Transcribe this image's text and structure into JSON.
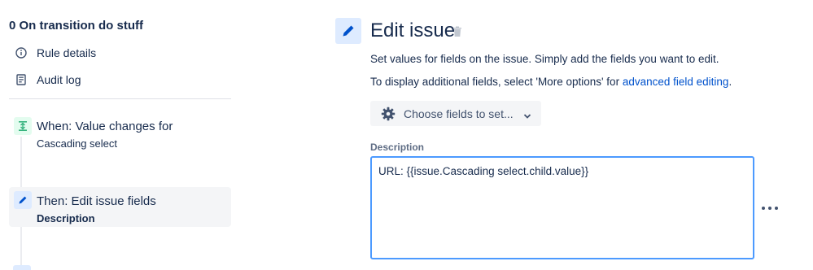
{
  "rule": {
    "title": "0 On transition do stuff",
    "menu": [
      {
        "label": "Rule details",
        "icon": "info-icon"
      },
      {
        "label": "Audit log",
        "icon": "audit-log-icon"
      }
    ],
    "steps": {
      "trigger": {
        "title": "When: Value changes for",
        "subtitle": "Cascading select",
        "icon": "trigger-icon"
      },
      "action": {
        "title": "Then: Edit issue fields",
        "subtitle": "Description",
        "icon": "pencil-icon"
      }
    }
  },
  "panel": {
    "title": "Edit issue",
    "description": "Set values for fields on the issue. Simply add the fields you want to edit.",
    "advanced_prefix": "To display additional fields, select 'More options' for ",
    "advanced_link": "advanced field editing",
    "advanced_suffix": ".",
    "choose_fields_label": "Choose fields to set...",
    "field_label": "Description",
    "field_value": "URL: {{issue.Cascading select.child.value}}"
  },
  "colors": {
    "accent_blue": "#0052cc",
    "focus_border": "#4c9aff",
    "trigger_green": "#36b37e",
    "selected_bg": "#f4f5f7"
  }
}
